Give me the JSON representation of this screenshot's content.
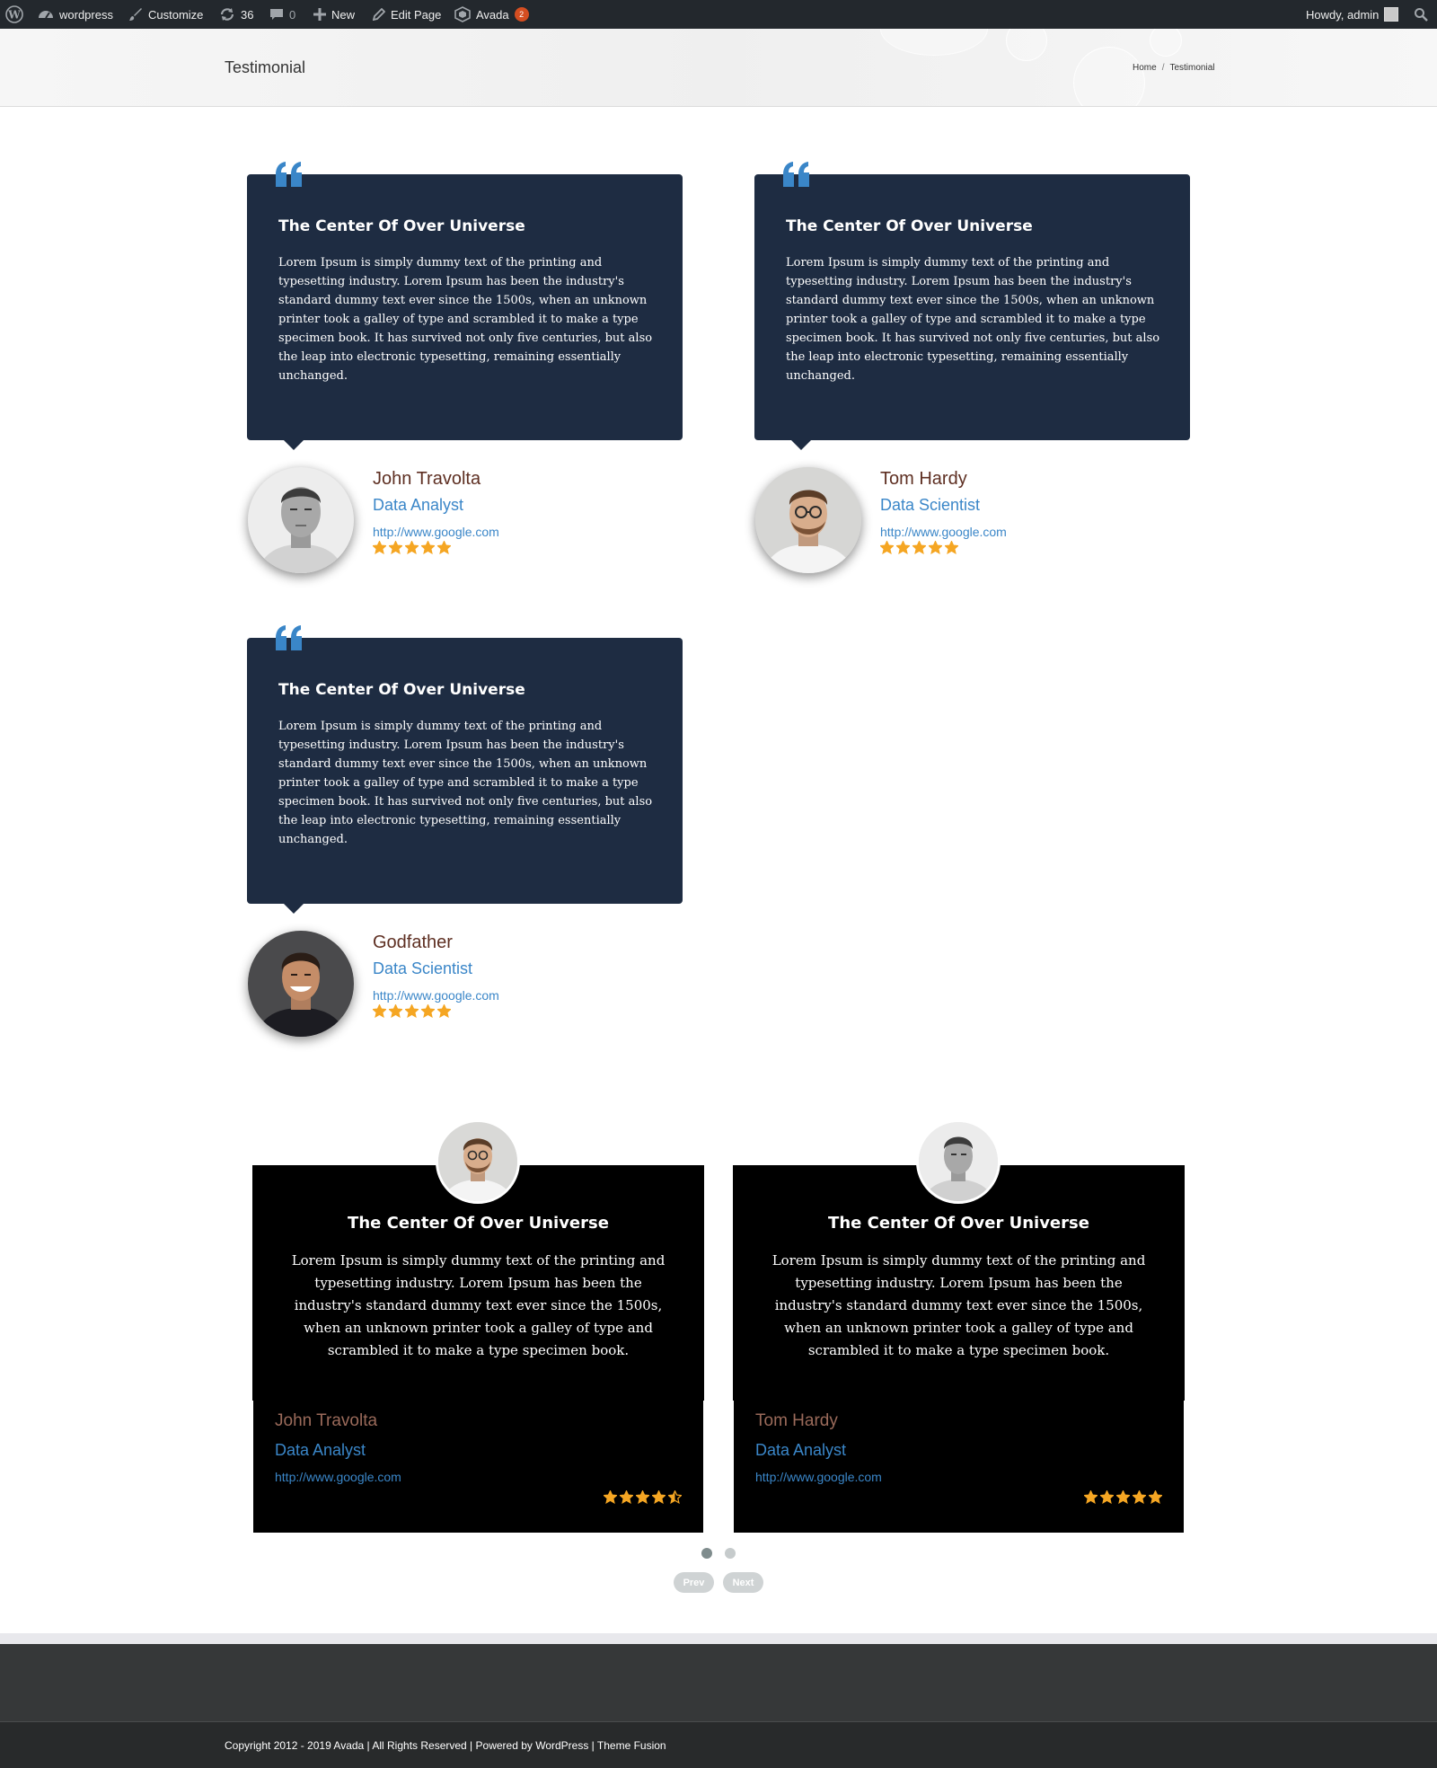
{
  "admin_bar": {
    "site_name": "wordpress",
    "customize": "Customize",
    "updates_count": "36",
    "comments_count": "0",
    "new": "New",
    "edit_page": "Edit Page",
    "avada": "Avada",
    "avada_badge": "2",
    "howdy": "Howdy, admin"
  },
  "page_title_bar": {
    "title": "Testimonial",
    "breadcrumb": [
      "Home",
      "Testimonial"
    ],
    "separator": "/"
  },
  "testimonials_style1": [
    {
      "title": "The Center Of Over Universe",
      "text": "Lorem Ipsum is simply dummy text of the printing and typesetting industry. Lorem Ipsum has been the industry's standard dummy text ever since the 1500s, when an unknown printer took a galley of type and scrambled it to make a type specimen book. It has survived not only five centuries, but also the leap into electronic typesetting, remaining essentially unchanged.",
      "name": "John Travolta",
      "role": "Data Analyst",
      "url": "http://www.google.com",
      "rating": 5
    },
    {
      "title": "The Center Of Over Universe",
      "text": "Lorem Ipsum is simply dummy text of the printing and typesetting industry. Lorem Ipsum has been the industry's standard dummy text ever since the 1500s, when an unknown printer took a galley of type and scrambled it to make a type specimen book. It has survived not only five centuries, but also the leap into electronic typesetting, remaining essentially unchanged.",
      "name": "Tom Hardy",
      "role": "Data Scientist",
      "url": "http://www.google.com",
      "rating": 5
    },
    {
      "title": "The Center Of Over Universe",
      "text": "Lorem Ipsum is simply dummy text of the printing and typesetting industry. Lorem Ipsum has been the industry's standard dummy text ever since the 1500s, when an unknown printer took a galley of type and scrambled it to make a type specimen book. It has survived not only five centuries, but also the leap into electronic typesetting, remaining essentially unchanged.",
      "name": "Godfather",
      "role": "Data Scientist",
      "url": "http://www.google.com",
      "rating": 5
    }
  ],
  "testimonials_carousel": [
    {
      "title": "The Center Of Over Universe",
      "text": "Lorem Ipsum is simply dummy text of the printing and typesetting industry. Lorem Ipsum has been the industry's standard dummy text ever since the 1500s, when an unknown printer took a galley of type and scrambled it to make a type specimen book.",
      "name": "John Travolta",
      "role": "Data Analyst",
      "url": "http://www.google.com",
      "rating": 4.5
    },
    {
      "title": "The Center Of Over Universe",
      "text": "Lorem Ipsum is simply dummy text of the printing and typesetting industry. Lorem Ipsum has been the industry's standard dummy text ever since the 1500s, when an unknown printer took a galley of type and scrambled it to make a type specimen book.",
      "name": "Tom Hardy",
      "role": "Data Analyst",
      "url": "http://www.google.com",
      "rating": 5
    }
  ],
  "carousel": {
    "active_page": 1,
    "page_count": 2,
    "prev": "Prev",
    "next": "Next"
  },
  "footer": {
    "copyright": "Copyright 2012 - 2019 Avada | All Rights Reserved | Powered by WordPress | Theme Fusion"
  },
  "colors": {
    "admin_bar": "#23282d",
    "card_navy": "#1e2c42",
    "card_black": "#000000",
    "accent_blue": "#3a86c8",
    "name_brown": "#5e2f22",
    "star_orange": "#f5a623",
    "footer": "#363839"
  }
}
